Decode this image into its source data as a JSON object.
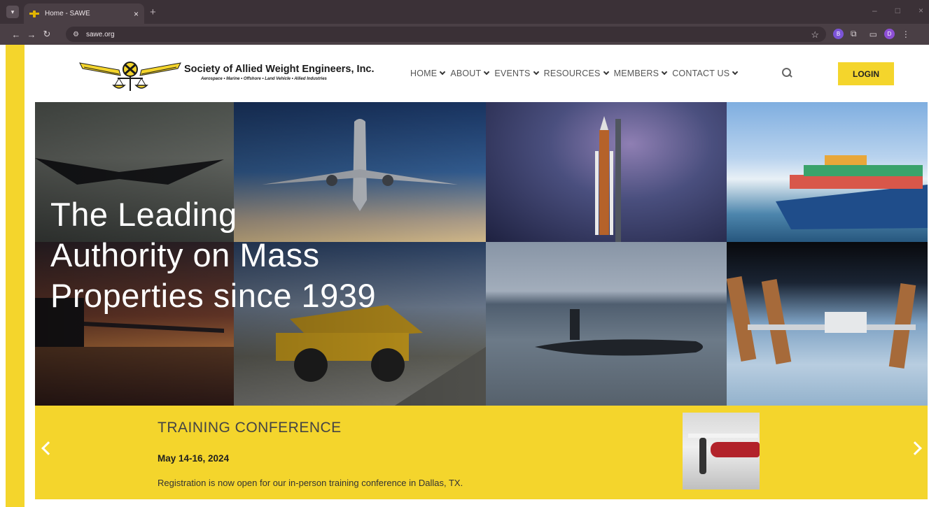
{
  "browser": {
    "tab_title": "Home - SAWE",
    "tab_close": "×",
    "new_tab": "+",
    "url": "sawe.org",
    "window_controls": [
      "–",
      "□",
      "×"
    ],
    "ext_badges": [
      "B",
      "D"
    ]
  },
  "header": {
    "org_name": "Society of Allied Weight Engineers, Inc.",
    "tagline": "Aerospace • Marine • Offshore • Land Vehicle • Allied Industries",
    "nav": [
      "HOME",
      "ABOUT",
      "EVENTS",
      "RESOURCES",
      "MEMBERS",
      "CONTACT US"
    ],
    "login_label": "LOGIN"
  },
  "hero": {
    "headline_lines": [
      "The Leading",
      "Authority on Mass",
      "Properties since 1939"
    ]
  },
  "slide": {
    "title": "TRAINING CONFERENCE",
    "date": "May 14-16, 2024",
    "text": "Registration is now open for our in-person training conference in Dallas, TX."
  },
  "colors": {
    "brand_yellow": "#f4d52c",
    "chrome_dark": "#3b3137"
  }
}
